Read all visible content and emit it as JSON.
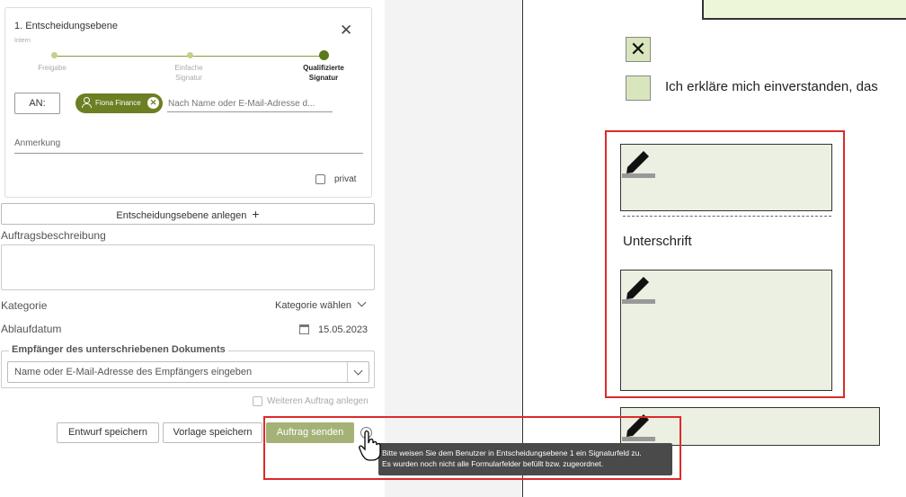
{
  "level": {
    "title": "1. Entscheidungsebene",
    "subtitle": "Intern",
    "steps": [
      "Freigabe",
      "Einfache Signatur",
      "Qualifizierte Signatur"
    ],
    "to_label": "AN:",
    "recipient_chip": "Fiona Finance",
    "recipient_placeholder": "Nach Name oder E-Mail-Adresse d...",
    "remark_label": "Anmerkung",
    "privat_label": "privat"
  },
  "add_level_label": "Entscheidungsebene anlegen",
  "description_label": "Auftragsbeschreibung",
  "category": {
    "label": "Kategorie",
    "value": "Kategorie wählen"
  },
  "expiry": {
    "label": "Ablaufdatum",
    "value": "15.05.2023"
  },
  "recipients": {
    "legend": "Empfänger des unterschriebenen Dokuments",
    "placeholder": "Name oder E-Mail-Adresse des Empfängers eingeben"
  },
  "another_order_label": "Weiteren Auftrag anlegen",
  "buttons": {
    "save_draft": "Entwurf speichern",
    "save_template": "Vorlage speichern",
    "send": "Auftrag senden"
  },
  "tooltip": {
    "line1": "Bitte weisen Sie dem Benutzer in Entscheidungsebene 1 ein Signaturfeld zu.",
    "line2": "Es wurden noch nicht alle Formularfelder befüllt bzw. zugeordnet."
  },
  "document": {
    "checkbox_mark": "✕",
    "consent_text": "Ich erkläre mich einverstanden, das",
    "signature_label": "Unterschrift"
  },
  "colors": {
    "accent": "#6b7f23",
    "send_disabled": "#a4b278",
    "highlight": "#dd2a2a",
    "field_bg": "#ecf0e2"
  },
  "icons": [
    "close-icon",
    "person-icon",
    "remove-icon",
    "plus-icon",
    "chevron-down-icon",
    "calendar-icon",
    "info-icon",
    "hand-cursor-icon",
    "pen-icon"
  ]
}
